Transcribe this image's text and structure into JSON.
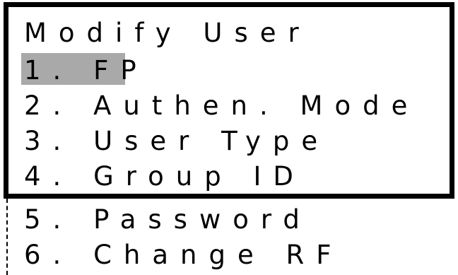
{
  "menu": {
    "title": "Modify User",
    "selected_index": 0,
    "items": [
      {
        "label": "1. FP"
      },
      {
        "label": "2. Authen. Mode"
      },
      {
        "label": "3. User Type"
      },
      {
        "label": "4. Group ID"
      },
      {
        "label": "5. Password"
      },
      {
        "label": "6. Change RF"
      }
    ]
  },
  "colors": {
    "text": "#000000",
    "background": "#ffffff",
    "frame": "#000000",
    "selection": "#a9a9a9"
  }
}
